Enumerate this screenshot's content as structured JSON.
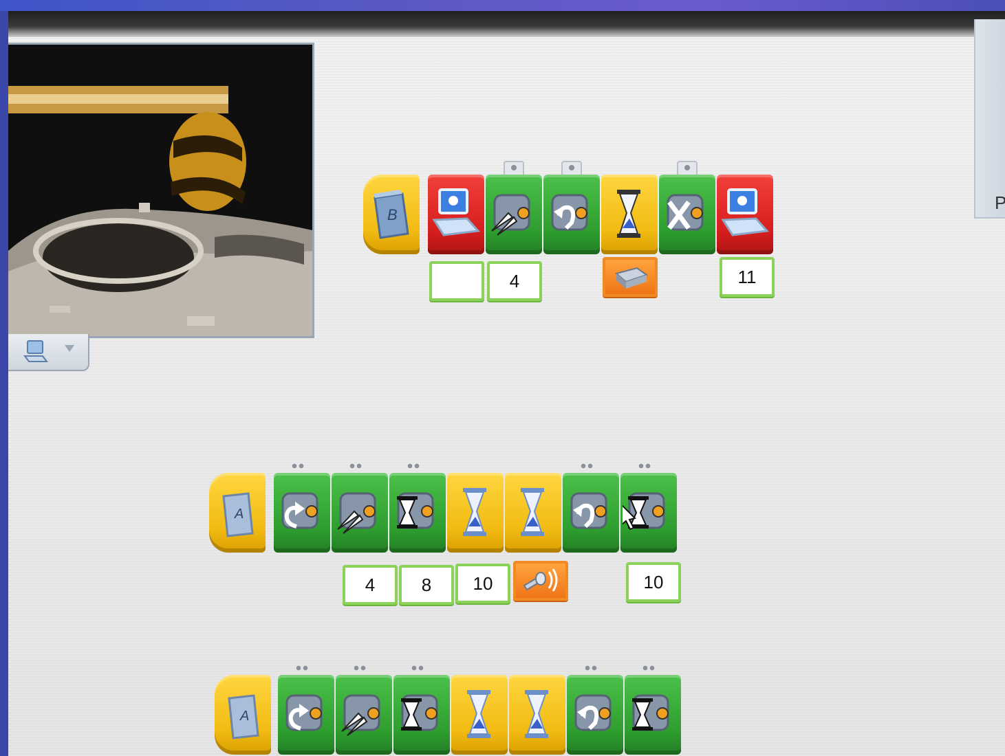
{
  "right_panel": {
    "partial_label": "P"
  },
  "scene": {
    "description_icon": "moon-crater-scene"
  },
  "toolbar": {
    "icons": [
      "computer-icon",
      "dropdown-arrow-icon"
    ]
  },
  "programs": [
    {
      "start_key": "B",
      "blocks": [
        "start-key-block",
        "display-block",
        "motor-power-block",
        "motor-direction-left-block",
        "wait-block",
        "motor-off-block",
        "display-block"
      ],
      "inputs": {
        "display": "",
        "motor_power": "4",
        "display_end": "11"
      }
    },
    {
      "start_key": "A",
      "blocks": [
        "start-key-block",
        "motor-direction-right-block",
        "motor-power-block",
        "motor-on-for-block",
        "wait-block",
        "wait-block",
        "motor-direction-left-block",
        "motor-on-for-block"
      ],
      "inputs": {
        "motor_power": "4",
        "motor_on_for": "8",
        "wait": "10",
        "motor_on_for_end": "10"
      }
    },
    {
      "start_key": "A",
      "blocks": [
        "start-key-block",
        "motor-direction-right-block",
        "motor-power-block",
        "motor-on-for-block",
        "wait-block",
        "wait-block",
        "motor-direction-left-block",
        "motor-on-for-block"
      ]
    }
  ]
}
